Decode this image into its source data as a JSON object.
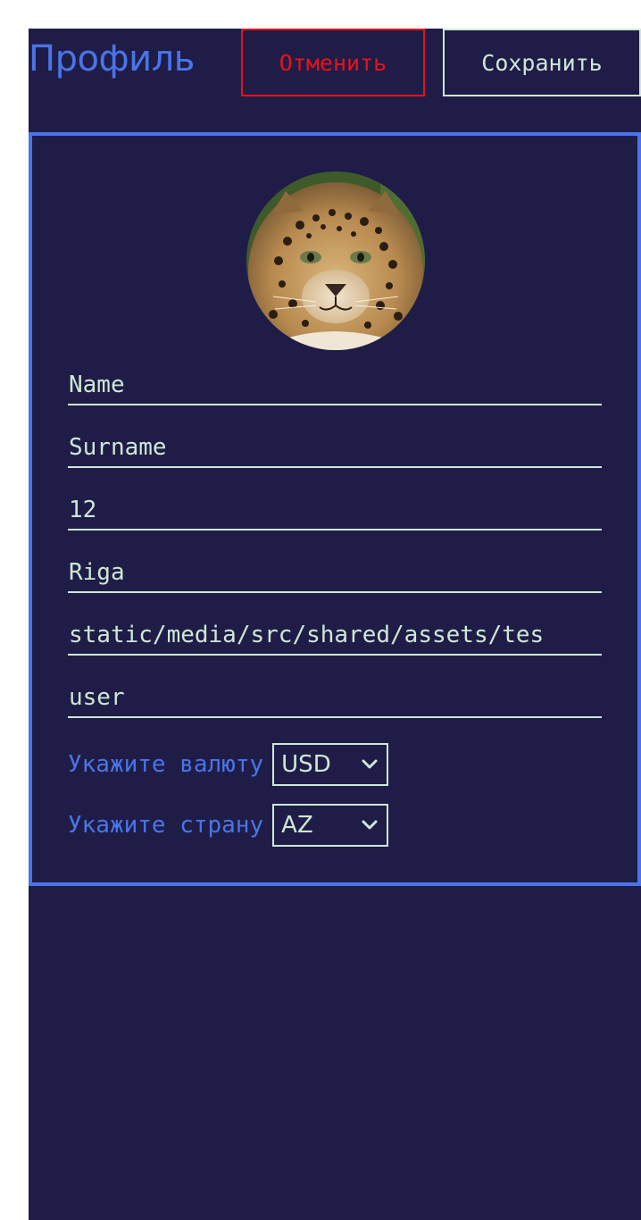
{
  "header": {
    "title": "Профиль",
    "cancel_label": "Отменить",
    "save_label": "Сохранить"
  },
  "profile": {
    "avatar": "leopard-avatar",
    "fields": {
      "first_name": "Name",
      "last_name": "Surname",
      "age": "12",
      "city": "Riga",
      "avatar_path": "static/media/src/shared/assets/tes",
      "username": "user"
    },
    "currency": {
      "label": "Укажите валюту",
      "selected": "USD"
    },
    "country": {
      "label": "Укажите страну",
      "selected": "AZ"
    }
  },
  "colors": {
    "background": "#1f1d47",
    "accent": "#4a74e8",
    "text": "#cfe7d6",
    "danger": "#e8111a"
  }
}
